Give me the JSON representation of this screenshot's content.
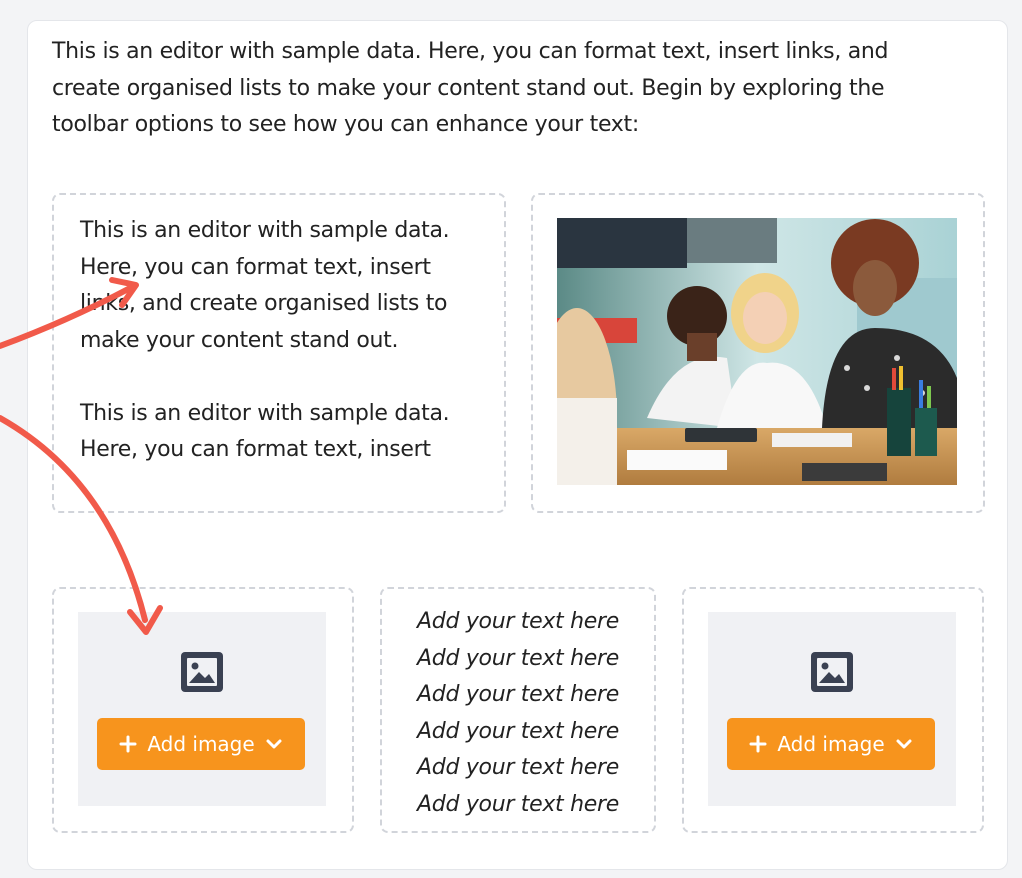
{
  "intro_text": "This is an editor with sample data. Here, you can format text, insert links, and create organised lists to make your content stand out. Begin by exploring the toolbar options to see how you can enhance your text:",
  "left_block": {
    "paragraph_1": "This is an editor with sample data. Here, you can format text, insert links, and create organised lists to make your content stand out.",
    "paragraph_2": "This is an editor with sample data. Here, you can format text, insert"
  },
  "image_block": {
    "icon": "photo-classroom"
  },
  "image_placeholders": [
    {
      "icon": "image-icon",
      "button_label": "Add image"
    },
    {
      "icon": "image-icon",
      "button_label": "Add image"
    }
  ],
  "text_list": {
    "items": [
      "Add your text here",
      "Add your text here",
      "Add your text here",
      "Add your text here",
      "Add your text here",
      "Add your text here"
    ]
  },
  "colors": {
    "accent": "#f7941d",
    "annotation_arrow": "#f15a4a",
    "icon_dark": "#3a4152",
    "dashed_border": "#d1d4da"
  }
}
